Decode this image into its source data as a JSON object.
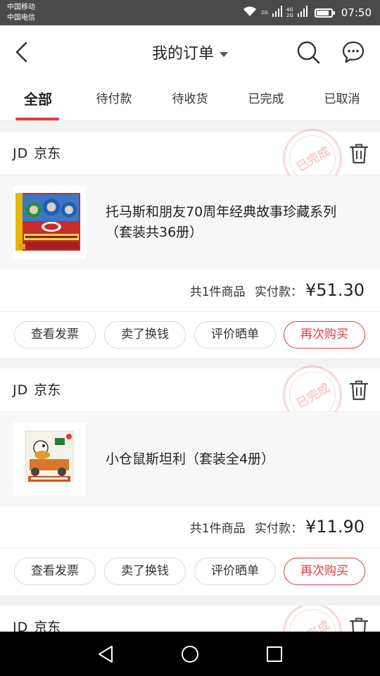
{
  "status_bar": {
    "carrier_1": "中国移动",
    "carrier_2": "中国电信",
    "net_1_top": "2G",
    "net_2_top": "4G",
    "net_2_bottom": "2G",
    "time": "07:50"
  },
  "header": {
    "title": "我的订单",
    "icons": [
      "back-arrow-icon",
      "search-icon",
      "message-icon"
    ]
  },
  "tabs": [
    {
      "label": "全部",
      "active": true
    },
    {
      "label": "待付款",
      "active": false
    },
    {
      "label": "待收货",
      "active": false
    },
    {
      "label": "已完成",
      "active": false
    },
    {
      "label": "已取消",
      "active": false
    }
  ],
  "orders": [
    {
      "shop_logo": "JD",
      "shop_name": "京东",
      "stamp": "已完成",
      "product_name": "托马斯和朋友70周年经典故事珍藏系列（套装共36册）",
      "count_text": "共1件商品",
      "paid_label": "实付款：",
      "price": "¥51.30",
      "buttons": [
        "查看发票",
        "卖了换钱",
        "评价晒单",
        "再次购买"
      ]
    },
    {
      "shop_logo": "JD",
      "shop_name": "京东",
      "stamp": "已完成",
      "product_name": "小仓鼠斯坦利（套装全4册）",
      "count_text": "共1件商品",
      "paid_label": "实付款：",
      "price": "¥11.90",
      "buttons": [
        "查看发票",
        "卖了换钱",
        "评价晒单",
        "再次购买"
      ]
    },
    {
      "shop_logo": "JD",
      "shop_name": "京东",
      "stamp": "已完成"
    }
  ],
  "colors": {
    "accent": "#e93b3d",
    "status_bar": "#4a4a4a",
    "background": "#f2f2f2"
  }
}
